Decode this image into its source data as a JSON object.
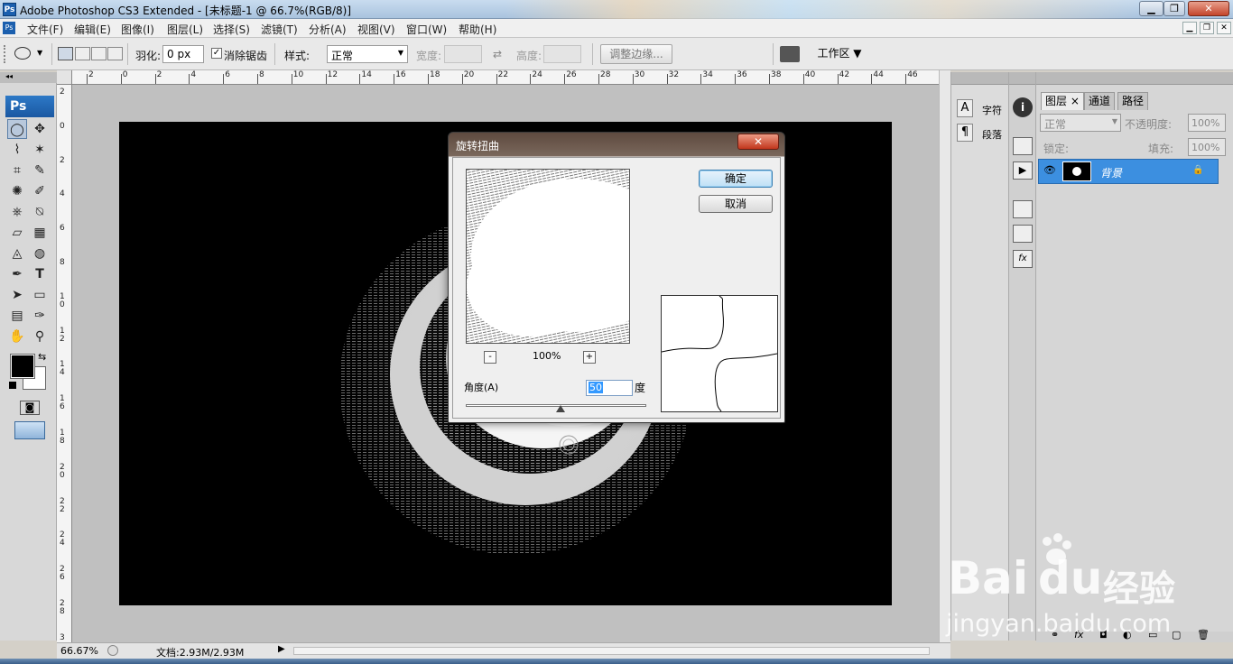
{
  "window": {
    "title": "Adobe Photoshop CS3 Extended - [未标题-1 @ 66.7%(RGB/8)]",
    "app_badge": "Ps",
    "minimize": "▁",
    "maximize": "❐",
    "close": "✕"
  },
  "menu": {
    "items": [
      "文件(F)",
      "编辑(E)",
      "图像(I)",
      "图层(L)",
      "选择(S)",
      "滤镜(T)",
      "分析(A)",
      "视图(V)",
      "窗口(W)",
      "帮助(H)"
    ],
    "mdi": [
      "▁",
      "❐",
      "✕"
    ]
  },
  "options": {
    "feather_label": "羽化:",
    "feather_value": "0 px",
    "antialias_label": "消除锯齿",
    "antialias_checked": "✓",
    "style_label": "样式:",
    "style_value": "正常",
    "width_label": "宽度:",
    "swap_icon": "⇄",
    "height_label": "高度:",
    "refine_button": "调整边缘...",
    "workspace_button": "工作区 ▼"
  },
  "toolbox": {
    "logo": "Ps",
    "tools": [
      "◯",
      "✥",
      "⌇",
      "✶",
      "⌗",
      "✎",
      "✺",
      "✐",
      "⎈",
      "⍉",
      "▱",
      "▦",
      "◬",
      "◍",
      "✒",
      "T",
      "➤",
      "▭",
      "▤",
      "✑",
      "✋",
      "⚲"
    ],
    "swap_icon": "⇆",
    "mask_icon": "◙"
  },
  "rulers": {
    "h_ticks": [
      "2",
      "0",
      "2",
      "4",
      "6",
      "8",
      "10",
      "12",
      "14",
      "16",
      "18",
      "20",
      "22",
      "24",
      "26",
      "28",
      "30",
      "32",
      "34",
      "36",
      "38",
      "40",
      "42",
      "44",
      "46"
    ],
    "v_ticks": [
      "2",
      "0",
      "2",
      "4",
      "6",
      "8",
      "1\n0",
      "1\n2",
      "1\n4",
      "1\n6",
      "1\n8",
      "2\n0",
      "2\n2",
      "2\n4",
      "2\n6",
      "2\n8",
      "3"
    ]
  },
  "statusbar": {
    "zoom": "66.67%",
    "doc_info": "文档:2.93M/2.93M",
    "arrow": "▶"
  },
  "dock": {
    "char_label": "字符",
    "para_label": "段落",
    "char_icon": "A",
    "para_icon": "¶"
  },
  "layers": {
    "tabs": [
      "图层 ×",
      "通道",
      "路径"
    ],
    "blend_mode": "正常",
    "opacity_label": "不透明度:",
    "opacity_value": "100%",
    "lock_label": "锁定:",
    "fill_label": "填充:",
    "fill_value": "100%",
    "layer_name": "背景",
    "eye_icon": "👁",
    "lock_icon": "🔒",
    "footer_icons": [
      "⚭",
      "fx",
      "◘",
      "◐",
      "▭",
      "▢",
      "🗑"
    ]
  },
  "dialog": {
    "title": "旋转扭曲",
    "close": "✕",
    "ok": "确定",
    "cancel": "取消",
    "zoom_minus": "-",
    "zoom_plus": "+",
    "zoom_value": "100%",
    "angle_label": "角度(A)",
    "angle_value": "50",
    "angle_unit": "度"
  },
  "watermark": {
    "brand": "Bai",
    "brand2": "du",
    "brand_cn": "经验",
    "url": "jingyan.baidu.com"
  }
}
